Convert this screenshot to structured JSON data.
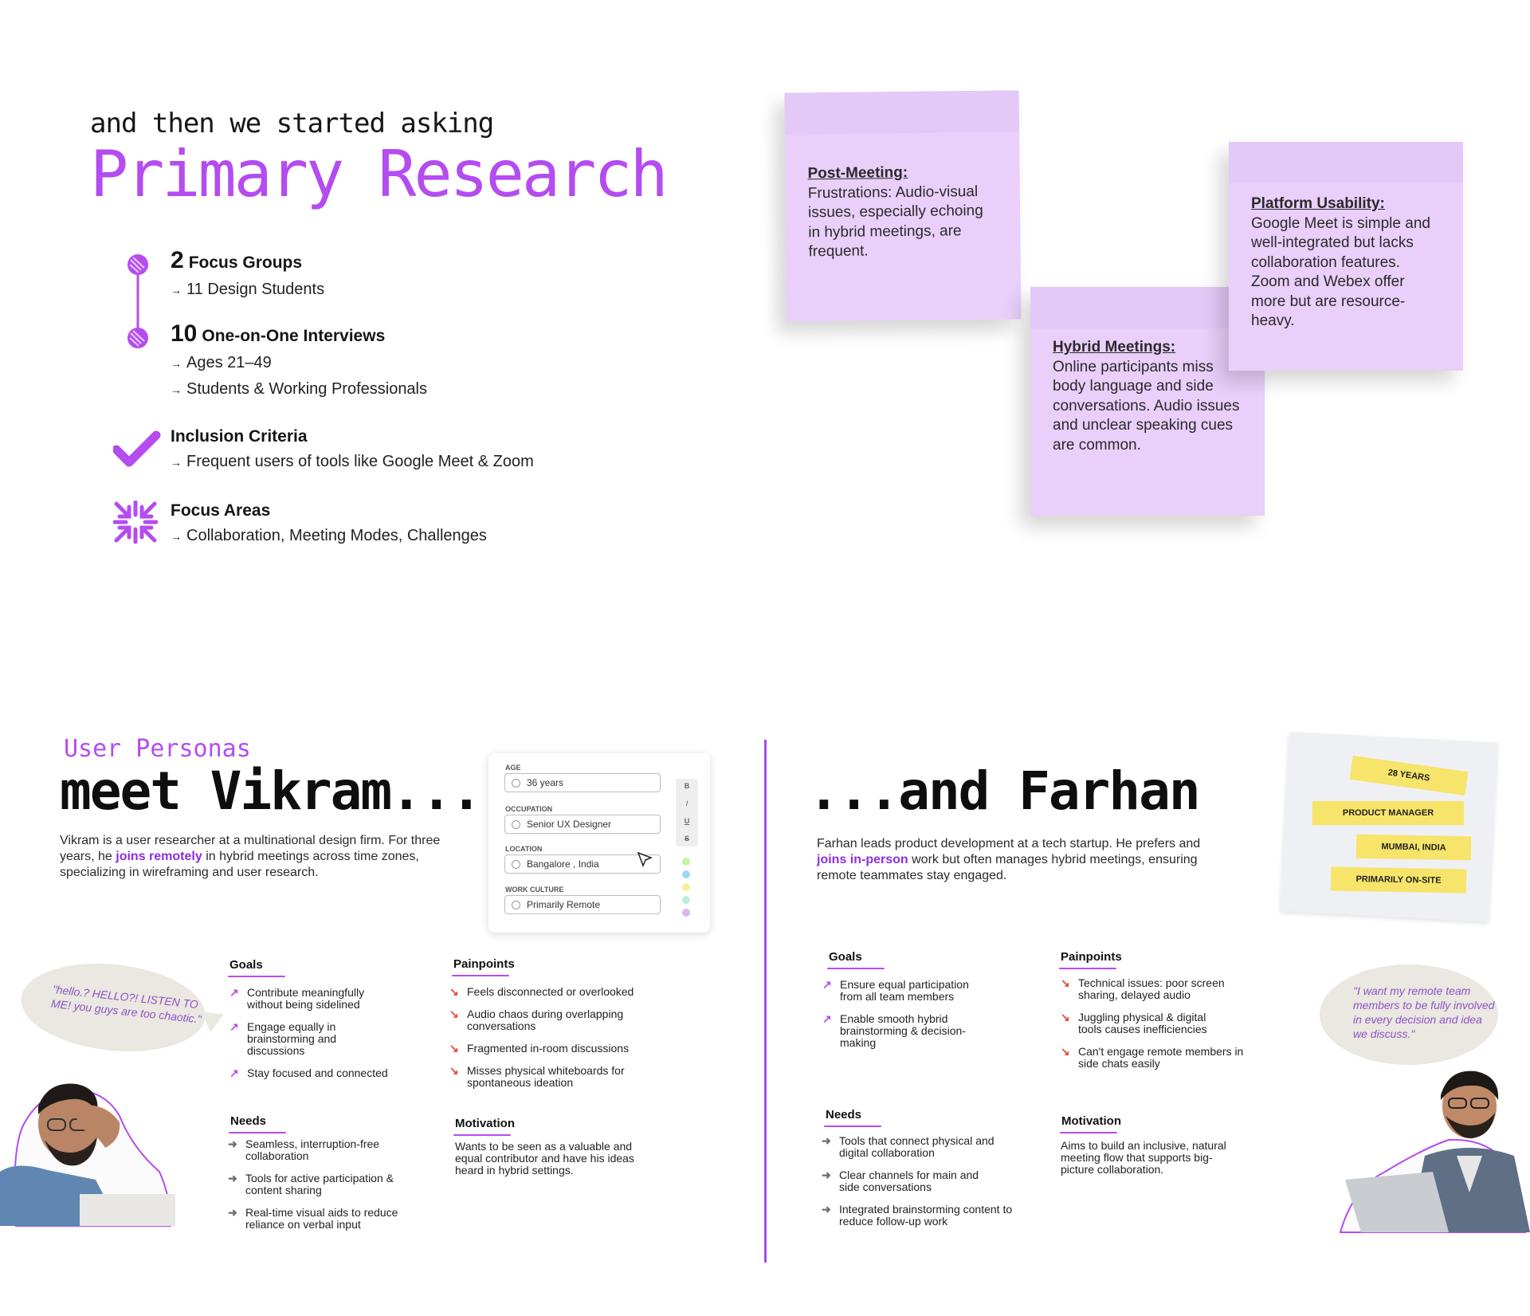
{
  "research": {
    "eyebrow": "and then we started asking",
    "title": "Primary Research",
    "focus_groups": {
      "number": "2",
      "label": "Focus Groups",
      "sub": "11 Design Students"
    },
    "interviews": {
      "number": "10",
      "label": "One-on-One Interviews",
      "subs": [
        "Ages 21–49",
        "Students & Working Professionals"
      ]
    },
    "inclusion": {
      "label": "Inclusion Criteria",
      "sub": "Frequent users of tools like Google Meet & Zoom"
    },
    "focus_areas": {
      "label": "Focus Areas",
      "sub": "Collaboration,  Meeting Modes,  Challenges"
    }
  },
  "notes": [
    {
      "heading": "Post-Meeting:",
      "body": "Frustrations: Audio-visual issues, especially echoing in hybrid meetings, are frequent."
    },
    {
      "heading": "Hybrid Meetings:",
      "body": "Online participants miss body language and side conversations. Audio issues and unclear speaking cues are common."
    },
    {
      "heading": "Platform Usability:",
      "body": "Google Meet is simple and well-integrated but lacks collaboration features. Zoom and Webex offer more but are resource-heavy."
    }
  ],
  "vikram": {
    "label": "User Personas",
    "title": "meet Vikram...",
    "desc_before": "Vikram is a user researcher at a multinational design firm. For three years, he ",
    "desc_highlight": "joins remotely",
    "desc_after": " in hybrid meetings across time zones, specializing in wireframing and user research.",
    "profile": {
      "age_label": "AGE",
      "age": "36 years",
      "occupation_label": "OCCUPATION",
      "occupation": "Senior UX Designer",
      "location_label": "LOCATION",
      "location": "Bangalore , India",
      "culture_label": "WORK CULTURE",
      "culture": "Primarily Remote",
      "tools": [
        "B",
        "I",
        "U",
        "S"
      ],
      "swatches": [
        "#c9f3a3",
        "#9fd8f5",
        "#f7ef9a",
        "#b6f0de",
        "#dcb5f5"
      ]
    },
    "quote": "\"hello.? HELLO?! LISTEN TO ME! you guys are too chaotic.\"",
    "goals_title": "Goals",
    "goals": [
      "Contribute meaningfully without being sidelined",
      "Engage equally in brainstorming and discussions",
      "Stay focused and connected"
    ],
    "pain_title": "Painpoints",
    "pains": [
      "Feels disconnected or overlooked",
      "Audio chaos during overlapping conversations",
      "Fragmented in-room discussions",
      "Misses physical whiteboards for spontaneous ideation"
    ],
    "needs_title": "Needs",
    "needs": [
      "Seamless, interruption-free collaboration",
      "Tools for active participation & content sharing",
      "Real-time visual aids to reduce reliance on verbal input"
    ],
    "motivation_title": "Motivation",
    "motivation": "Wants to be seen as a valuable and equal contributor and have his ideas heard in hybrid settings."
  },
  "farhan": {
    "title": "...and Farhan",
    "desc_before": "Farhan leads product development at a tech startup. He prefers and ",
    "desc_highlight": "joins in-person",
    "desc_after": " work but often manages hybrid meetings, ensuring remote teammates stay engaged.",
    "tags": [
      "28 YEARS",
      "PRODUCT MANAGER",
      "MUMBAI, INDIA",
      "PRIMARILY ON-SITE"
    ],
    "quote": "\"I want my remote team members to be fully involved in every decision and idea we discuss.\"",
    "goals_title": "Goals",
    "goals": [
      "Ensure equal participation from all team members",
      "Enable smooth hybrid brainstorming & decision-making"
    ],
    "pain_title": "Painpoints",
    "pains": [
      "Technical issues: poor screen sharing, delayed audio",
      "Juggling physical & digital tools causes inefficiencies",
      "Can't engage remote members in side chats easily"
    ],
    "needs_title": "Needs",
    "needs": [
      "Tools that connect physical and digital collaboration",
      "Clear channels for main and side conversations",
      "Integrated brainstorming content to reduce follow-up work"
    ],
    "motivation_title": "Motivation",
    "motivation": "Aims to build an inclusive, natural meeting flow that supports big-picture collaboration."
  },
  "colors": {
    "accent": "#b44cf0",
    "note": "#e9cff9",
    "tag": "#f7e46a",
    "pain_arrow": "#e8473b"
  }
}
